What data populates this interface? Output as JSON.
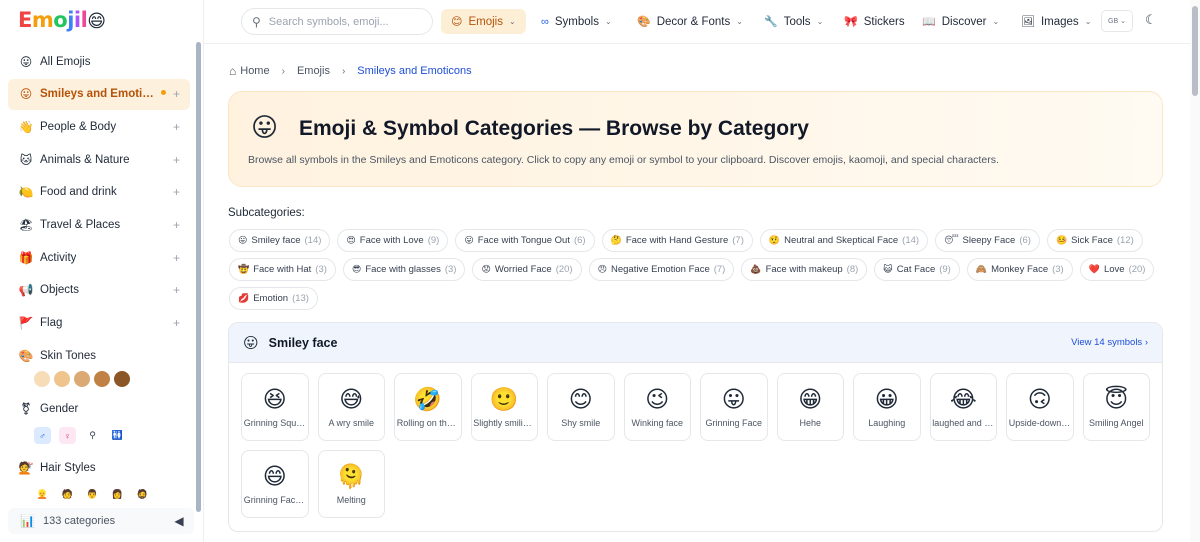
{
  "app": {
    "logo_parts": [
      "E",
      "m",
      "o",
      "j",
      "i",
      "l",
      "😄"
    ]
  },
  "sidebar": {
    "items": [
      {
        "icon": "😛",
        "label": "All Emojis",
        "active": false,
        "plus": false
      },
      {
        "icon": "😛",
        "label": "Smileys and Emoticons",
        "active": true,
        "plus": true
      },
      {
        "icon": "👋",
        "label": "People & Body",
        "active": false,
        "plus": true
      },
      {
        "icon": "🐱",
        "label": "Animals & Nature",
        "active": false,
        "plus": true
      },
      {
        "icon": "🍋",
        "label": "Food and drink",
        "active": false,
        "plus": true
      },
      {
        "icon": "🏖",
        "label": "Travel & Places",
        "active": false,
        "plus": true
      },
      {
        "icon": "🎁",
        "label": "Activity",
        "active": false,
        "plus": true
      },
      {
        "icon": "📢",
        "label": "Objects",
        "active": false,
        "plus": true
      },
      {
        "icon": "🚩",
        "label": "Flag",
        "active": false,
        "plus": true
      }
    ],
    "skin_tones": {
      "icon": "🎨",
      "label": "Skin Tones",
      "colors": [
        "#f7dcb8",
        "#efc58d",
        "#dba974",
        "#c08144",
        "#8b5727"
      ]
    },
    "gender": {
      "icon": "⚧",
      "label": "Gender",
      "items": [
        "♂",
        "♀",
        "⚲",
        "🚻"
      ]
    },
    "hair_styles": {
      "icon": "💇",
      "label": "Hair Styles",
      "items": [
        "👱",
        "🧑",
        "👨",
        "👩",
        "🧔"
      ]
    },
    "footer": {
      "icon": "📊",
      "label": "133 categories",
      "collapse": "◀"
    }
  },
  "topbar": {
    "search_placeholder": "Search symbols, emoji...",
    "nav": [
      {
        "icon": "😊",
        "label": "Emojis",
        "chevron": true,
        "active": true
      },
      {
        "icon": "∞",
        "label": "Symbols",
        "chevron": true,
        "active": false
      },
      {
        "icon": "🎨",
        "label": "Decor & Fonts",
        "chevron": true,
        "active": false
      },
      {
        "icon": "🔧",
        "label": "Tools",
        "chevron": true,
        "active": false
      },
      {
        "icon": "🎀",
        "label": "Stickers",
        "chevron": false,
        "active": false
      },
      {
        "icon": "📖",
        "label": "Discover",
        "chevron": true,
        "active": false
      },
      {
        "icon": "🖼",
        "label": "Images",
        "chevron": true,
        "active": false
      }
    ],
    "language": "GB ⌄",
    "theme_icon": "☾"
  },
  "breadcrumb": {
    "home_icon": "⌂",
    "items": [
      "Home",
      "Emojis",
      "Smileys and Emoticons"
    ],
    "separator": "›"
  },
  "hero": {
    "icon": "😛",
    "title": "Emoji & Symbol Categories — Browse by Category",
    "description": "Browse all symbols in the Smileys and Emoticons category. Click to copy any emoji or symbol to your clipboard. Discover emojis, kaomoji, and special characters."
  },
  "subcategories": {
    "title": "Subcategories:",
    "chips": [
      {
        "icon": "😛",
        "label": "Smiley face",
        "count": "(14)"
      },
      {
        "icon": "😍",
        "label": "Face with Love",
        "count": "(9)"
      },
      {
        "icon": "😛",
        "label": "Face with Tongue Out",
        "count": "(6)"
      },
      {
        "icon": "🤔",
        "label": "Face with Hand Gesture",
        "count": "(7)"
      },
      {
        "icon": "🤨",
        "label": "Neutral and Skeptical Face",
        "count": "(14)"
      },
      {
        "icon": "😴",
        "label": "Sleepy Face",
        "count": "(6)"
      },
      {
        "icon": "🤒",
        "label": "Sick Face",
        "count": "(12)"
      },
      {
        "icon": "🤠",
        "label": "Face with Hat",
        "count": "(3)"
      },
      {
        "icon": "😎",
        "label": "Face with glasses",
        "count": "(3)"
      },
      {
        "icon": "😟",
        "label": "Worried Face",
        "count": "(20)"
      },
      {
        "icon": "😠",
        "label": "Negative Emotion Face",
        "count": "(7)"
      },
      {
        "icon": "💩",
        "label": "Face with makeup",
        "count": "(8)"
      },
      {
        "icon": "😺",
        "label": "Cat Face",
        "count": "(9)"
      },
      {
        "icon": "🙈",
        "label": "Monkey Face",
        "count": "(3)"
      },
      {
        "icon": "❤️",
        "label": "Love",
        "count": "(20)"
      },
      {
        "icon": "💋",
        "label": "Emotion",
        "count": "(13)"
      }
    ]
  },
  "section": {
    "icon": "😛",
    "title": "Smiley face",
    "view_link": "View 14 symbols ›",
    "emojis": [
      {
        "emoji": "😆",
        "name": "Grinning Squinting Face"
      },
      {
        "emoji": "😅",
        "name": "A wry smile"
      },
      {
        "emoji": "🤣",
        "name": "Rolling on the floor laughing"
      },
      {
        "emoji": "🙂",
        "name": "Slightly smiling face"
      },
      {
        "emoji": "😊",
        "name": "Shy smile"
      },
      {
        "emoji": "😉",
        "name": "Winking face"
      },
      {
        "emoji": "😛",
        "name": "Grinning Face"
      },
      {
        "emoji": "😁",
        "name": "Hehe"
      },
      {
        "emoji": "😀",
        "name": "Laughing"
      },
      {
        "emoji": "😂",
        "name": "laughed and cried"
      },
      {
        "emoji": "🙃",
        "name": "Upside-down face"
      },
      {
        "emoji": "😇",
        "name": "Smiling Angel"
      },
      {
        "emoji": "😄",
        "name": "Grinning Face with Smiling Eyes"
      },
      {
        "emoji": "🫠",
        "name": "Melting"
      }
    ]
  }
}
